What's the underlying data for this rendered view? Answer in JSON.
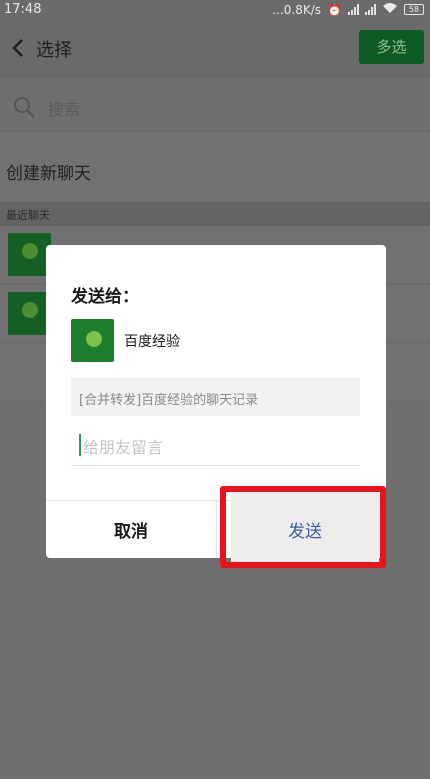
{
  "status_bar": {
    "time": "17:48",
    "speed": "...0.8K/s",
    "battery": "58"
  },
  "header": {
    "title": "选择",
    "multi_select": "多选"
  },
  "search": {
    "placeholder": "搜索"
  },
  "new_chat": "创建新聊天",
  "recent_section": "最近聊天",
  "dialog": {
    "title": "发送给：",
    "contact_name": "百度经验",
    "contact_thumb_text": "百度经验",
    "record_text": "[合并转发]百度经验的聊天记录",
    "message_placeholder": "给朋友留言",
    "cancel": "取消",
    "send": "发送"
  },
  "colors": {
    "accent_green": "#1aa64a",
    "send_blue": "#3c5aa8",
    "highlight_red": "#e8131b"
  }
}
